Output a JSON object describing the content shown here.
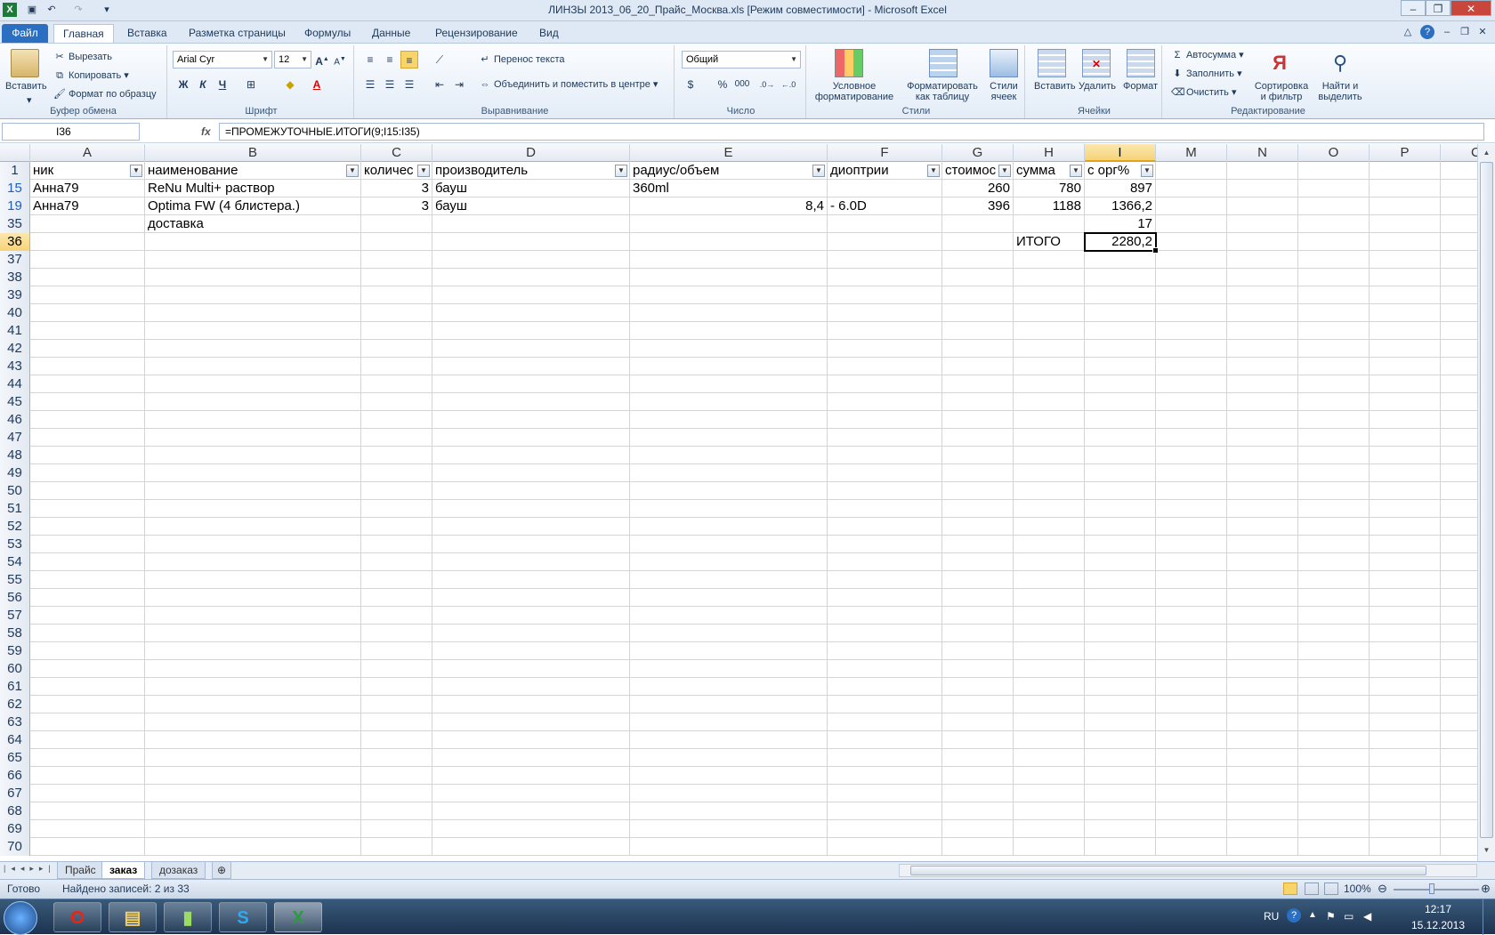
{
  "window": {
    "title": "ЛИНЗЫ 2013_06_20_Прайс_Москва.xls  [Режим совместимости]  -  Microsoft Excel"
  },
  "ribbon_tabs": [
    "Файл",
    "Главная",
    "Вставка",
    "Разметка страницы",
    "Формулы",
    "Данные",
    "Рецензирование",
    "Вид"
  ],
  "clipboard": {
    "paste": "Вставить",
    "cut": "Вырезать",
    "copy": "Копировать",
    "format_painter": "Формат по образцу",
    "label": "Буфер обмена"
  },
  "font": {
    "name": "Arial Cyr",
    "size": "12",
    "bold": "Ж",
    "italic": "К",
    "underline": "Ч",
    "label": "Шрифт"
  },
  "alignment": {
    "wrap": "Перенос текста",
    "merge": "Объединить и поместить в центре",
    "label": "Выравнивание"
  },
  "number": {
    "format": "Общий",
    "label": "Число",
    "percent": "%",
    "thousands": "000"
  },
  "styles": {
    "conditional_1": "Условное",
    "conditional_2": "форматирование",
    "table_1": "Форматировать",
    "table_2": "как таблицу",
    "cell_1": "Стили",
    "cell_2": "ячеек",
    "label": "Стили"
  },
  "cells": {
    "insert": "Вставить",
    "delete": "Удалить",
    "format": "Формат",
    "label": "Ячейки"
  },
  "editing": {
    "autosum": "Автосумма",
    "fill": "Заполнить",
    "clear": "Очистить",
    "sort_1": "Сортировка",
    "sort_2": "и фильтр",
    "find_1": "Найти и",
    "find_2": "выделить",
    "label": "Редактирование"
  },
  "formula_bar": {
    "name_box": "I36",
    "fx": "fx",
    "formula": "=ПРОМЕЖУТОЧНЫЕ.ИТОГИ(9;I15:I35)"
  },
  "columns": [
    "A",
    "B",
    "C",
    "D",
    "E",
    "F",
    "G",
    "H",
    "I",
    "M",
    "N",
    "O",
    "P",
    "C"
  ],
  "header_row": {
    "num": "1",
    "A": "ник",
    "B": "наименование",
    "C": "количес",
    "D": "производитель",
    "E": "радиус/объем",
    "F": "диоптрии",
    "G": "стоимос",
    "H": "сумма",
    "I": "с орг%"
  },
  "rows": [
    {
      "num": "15",
      "A": "Анна79",
      "B": "ReNu Multi+ раствор",
      "C": "3",
      "D": "бауш",
      "E": "360ml",
      "F": "",
      "G": "260",
      "H": "780",
      "I": "897"
    },
    {
      "num": "19",
      "A": "Анна79",
      "B": "Optima FW (4 блистера.)",
      "C": "3",
      "D": "бауш",
      "E": "8,4",
      "F": " - 6.0D",
      "G": "396",
      "H": "1188",
      "I": "1366,2"
    },
    {
      "num": "35",
      "A": "",
      "B": "доставка",
      "C": "",
      "D": "",
      "E": "",
      "F": "",
      "G": "",
      "H": "",
      "I": "17"
    },
    {
      "num": "36",
      "A": "",
      "B": "",
      "C": "",
      "D": "",
      "E": "",
      "F": "",
      "G": "",
      "H": "ИТОГО",
      "I": "2280,2"
    }
  ],
  "empty_rows": [
    "37",
    "38",
    "39",
    "40",
    "41",
    "42",
    "43",
    "44",
    "45",
    "46",
    "47",
    "48",
    "49",
    "50",
    "51",
    "52",
    "53",
    "54",
    "55",
    "56",
    "57",
    "58",
    "59",
    "60",
    "61",
    "62",
    "63",
    "64",
    "65",
    "66",
    "67",
    "68",
    "69",
    "70"
  ],
  "sheets": [
    "Прайс",
    "заказ",
    "дозаказ"
  ],
  "status": {
    "ready": "Готово",
    "found": "Найдено записей: 2 из 33",
    "zoom": "100%"
  },
  "tray": {
    "lang": "RU",
    "time": "12:17",
    "date": "15.12.2013"
  }
}
